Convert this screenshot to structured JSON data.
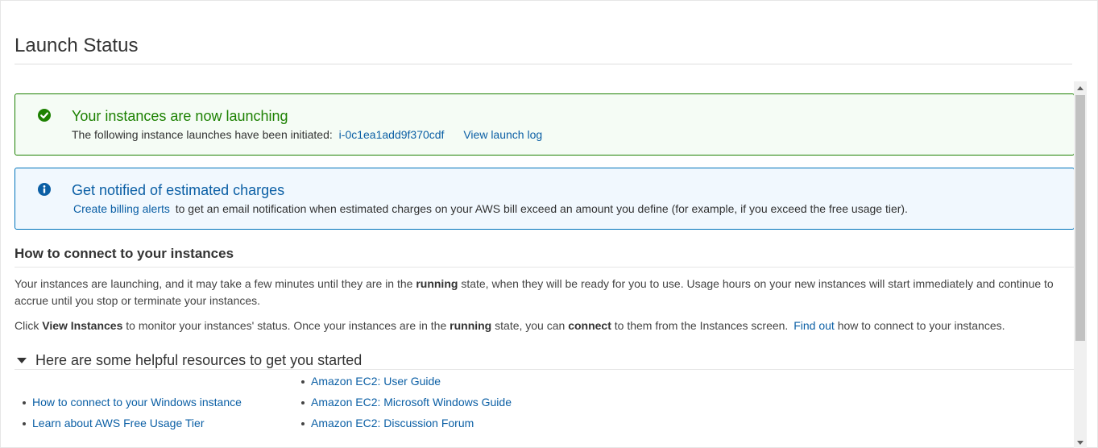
{
  "page": {
    "title": "Launch Status"
  },
  "success_alert": {
    "icon": "check-circle-icon",
    "title": "Your instances are now launching",
    "body_text": "The following instance launches have been initiated:",
    "instance_id": "i-0c1ea1add9f370cdf",
    "log_link": "View launch log",
    "color": "#1d8102"
  },
  "info_alert": {
    "icon": "info-circle-icon",
    "title": "Get notified of estimated charges",
    "link_text": "Create billing alerts",
    "body_text": "to get an email notification when estimated charges on your AWS bill exceed an amount you define (for example, if you exceed the free usage tier).",
    "color": "#0b5fa5"
  },
  "connect": {
    "title": "How to connect to your instances",
    "p1_a": "Your instances are launching, and it may take a few minutes until they are in the",
    "p1_bold": "running",
    "p1_b": "state, when they will be ready for you to use. Usage hours on your new instances will start immediately and continue to accrue until you stop or terminate your instances.",
    "p2_a": "Click",
    "p2_bold1": "View Instances",
    "p2_b": "to monitor your instances' status. Once your instances are in the",
    "p2_bold2": "running",
    "p2_c": "state, you can",
    "p2_bold3": "connect",
    "p2_d": "to them from the Instances screen.",
    "p2_link": "Find out",
    "p2_e": "how to connect to your instances."
  },
  "resources": {
    "title": "Here are some helpful resources to get you started",
    "left_links": [
      "How to connect to your Windows instance",
      "Learn about AWS Free Usage Tier"
    ],
    "right_links": [
      "Amazon EC2: User Guide",
      "Amazon EC2: Microsoft Windows Guide",
      "Amazon EC2: Discussion Forum"
    ]
  }
}
